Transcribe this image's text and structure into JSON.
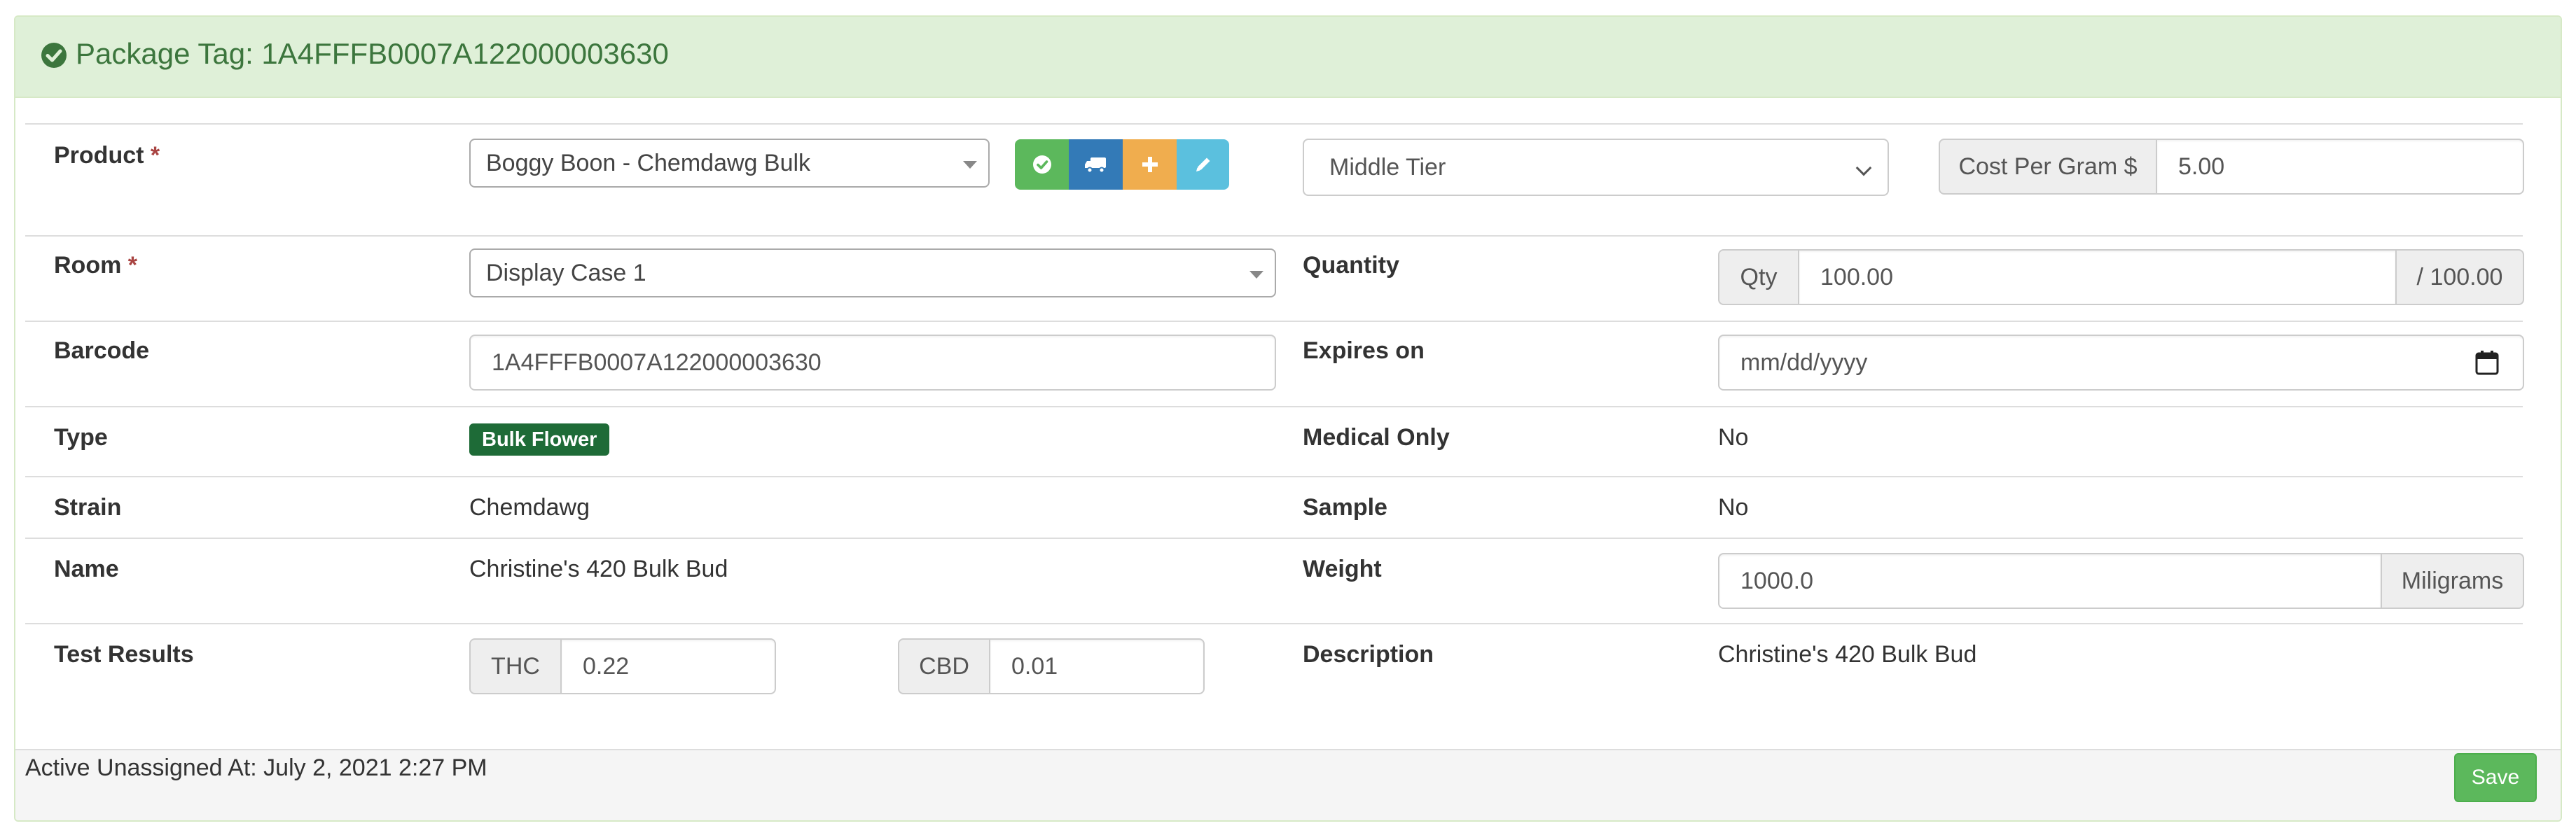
{
  "header": {
    "title": "Package Tag: 1A4FFFB0007A122000003630",
    "icon": "check-circle-icon"
  },
  "product": {
    "label": "Product",
    "required_mark": "*",
    "selected": "Boggy Boon - Chemdawg Bulk",
    "action_icons": [
      "check-icon",
      "truck-icon",
      "plus-icon",
      "pencil-icon"
    ],
    "tier": "Middle Tier",
    "cost_label": "Cost Per Gram $",
    "cost_value": "5.00"
  },
  "room": {
    "label": "Room",
    "required_mark": "*",
    "selected": "Display Case 1"
  },
  "quantity": {
    "label": "Quantity",
    "prefix": "Qty",
    "value": "100.00",
    "suffix": "/ 100.00"
  },
  "barcode": {
    "label": "Barcode",
    "value": "1A4FFFB0007A122000003630"
  },
  "expires": {
    "label": "Expires on",
    "placeholder": "mm/dd/yyyy",
    "icon": "calendar-icon"
  },
  "type": {
    "label": "Type",
    "badge": "Bulk Flower"
  },
  "medical_only": {
    "label": "Medical Only",
    "value": "No"
  },
  "strain": {
    "label": "Strain",
    "value": "Chemdawg"
  },
  "sample": {
    "label": "Sample",
    "value": "No"
  },
  "name": {
    "label": "Name",
    "value": "Christine's 420 Bulk Bud"
  },
  "weight": {
    "label": "Weight",
    "value": "1000.0",
    "unit": "Miligrams"
  },
  "test_results": {
    "label": "Test Results",
    "thc_label": "THC",
    "thc_value": "0.22",
    "cbd_label": "CBD",
    "cbd_value": "0.01"
  },
  "description": {
    "label": "Description",
    "value": "Christine's 420 Bulk Bud"
  },
  "footer": {
    "status": "Active Unassigned At: July 2, 2021 2:27 PM",
    "save_label": "Save"
  },
  "colors": {
    "success": "#5cb85c",
    "primary": "#337ab7",
    "warning": "#f0ad4e",
    "info": "#5bc0de",
    "heading_bg": "#dff0d8",
    "heading_text": "#3c763d",
    "badge": "#1e6b37"
  }
}
